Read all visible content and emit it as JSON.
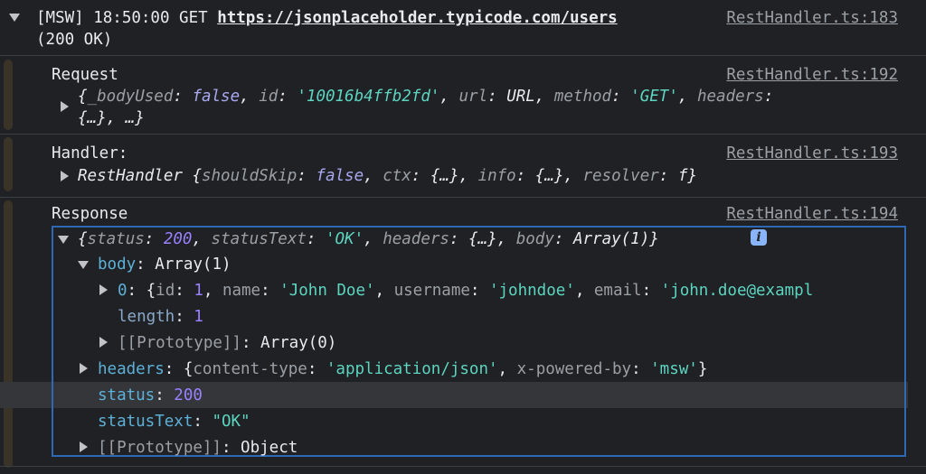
{
  "header": {
    "prefix": "[MSW] 18:50:00 GET ",
    "url": "https://jsonplaceholder.typicode.com/users",
    "status": "(200 OK)",
    "source": "RestHandler.ts:183"
  },
  "request": {
    "title": "Request",
    "source": "RestHandler.ts:192",
    "line1": {
      "k1": "_bodyUsed",
      "v1": "false",
      "k2": "id",
      "v2": "'10016b4ffb2fd'",
      "k3": "url",
      "v3": "URL",
      "k4": "method",
      "v4": "'GET'",
      "k5": "headers"
    },
    "line2": "{…}, …}"
  },
  "handler": {
    "title": "Handler:",
    "source": "RestHandler.ts:193",
    "class_name": "RestHandler",
    "k1": "shouldSkip",
    "v1": "false",
    "k2": "ctx",
    "v2": "{…}",
    "k3": "info",
    "v3": "{…}",
    "k4": "resolver",
    "v4": "f"
  },
  "response": {
    "title": "Response",
    "source": "RestHandler.ts:194",
    "summary": {
      "k1": "status",
      "v1": "200",
      "k2": "statusText",
      "v2": "'OK'",
      "k3": "headers",
      "v3": "{…}",
      "k4": "body",
      "v4": "Array(1)"
    },
    "info_icon": "i",
    "body": {
      "key": "body",
      "value": "Array(1)",
      "item0": {
        "index": "0",
        "k1": "id",
        "v1": "1",
        "k2": "name",
        "v2": "'John Doe'",
        "k3": "username",
        "v3": "'johndoe'",
        "k4": "email",
        "v4": "'john.doe@exampl"
      },
      "length_key": "length",
      "length_value": "1",
      "proto_key": "[[Prototype]]",
      "proto_value": "Array(0)"
    },
    "headers": {
      "key": "headers",
      "k1": "content-type",
      "v1": "'application/json'",
      "k2": "x-powered-by",
      "v2": "'msw'"
    },
    "status": {
      "key": "status",
      "value": "200"
    },
    "statusText": {
      "key": "statusText",
      "value": "\"OK\""
    },
    "proto": {
      "key": "[[Prototype]]",
      "value": "Object"
    }
  },
  "colors": {
    "background": "#202124",
    "key_purple": "#5db0d7",
    "string_teal": "#5cd5c0",
    "number_violet": "#9980ff",
    "selection_border": "#2e69b5"
  }
}
